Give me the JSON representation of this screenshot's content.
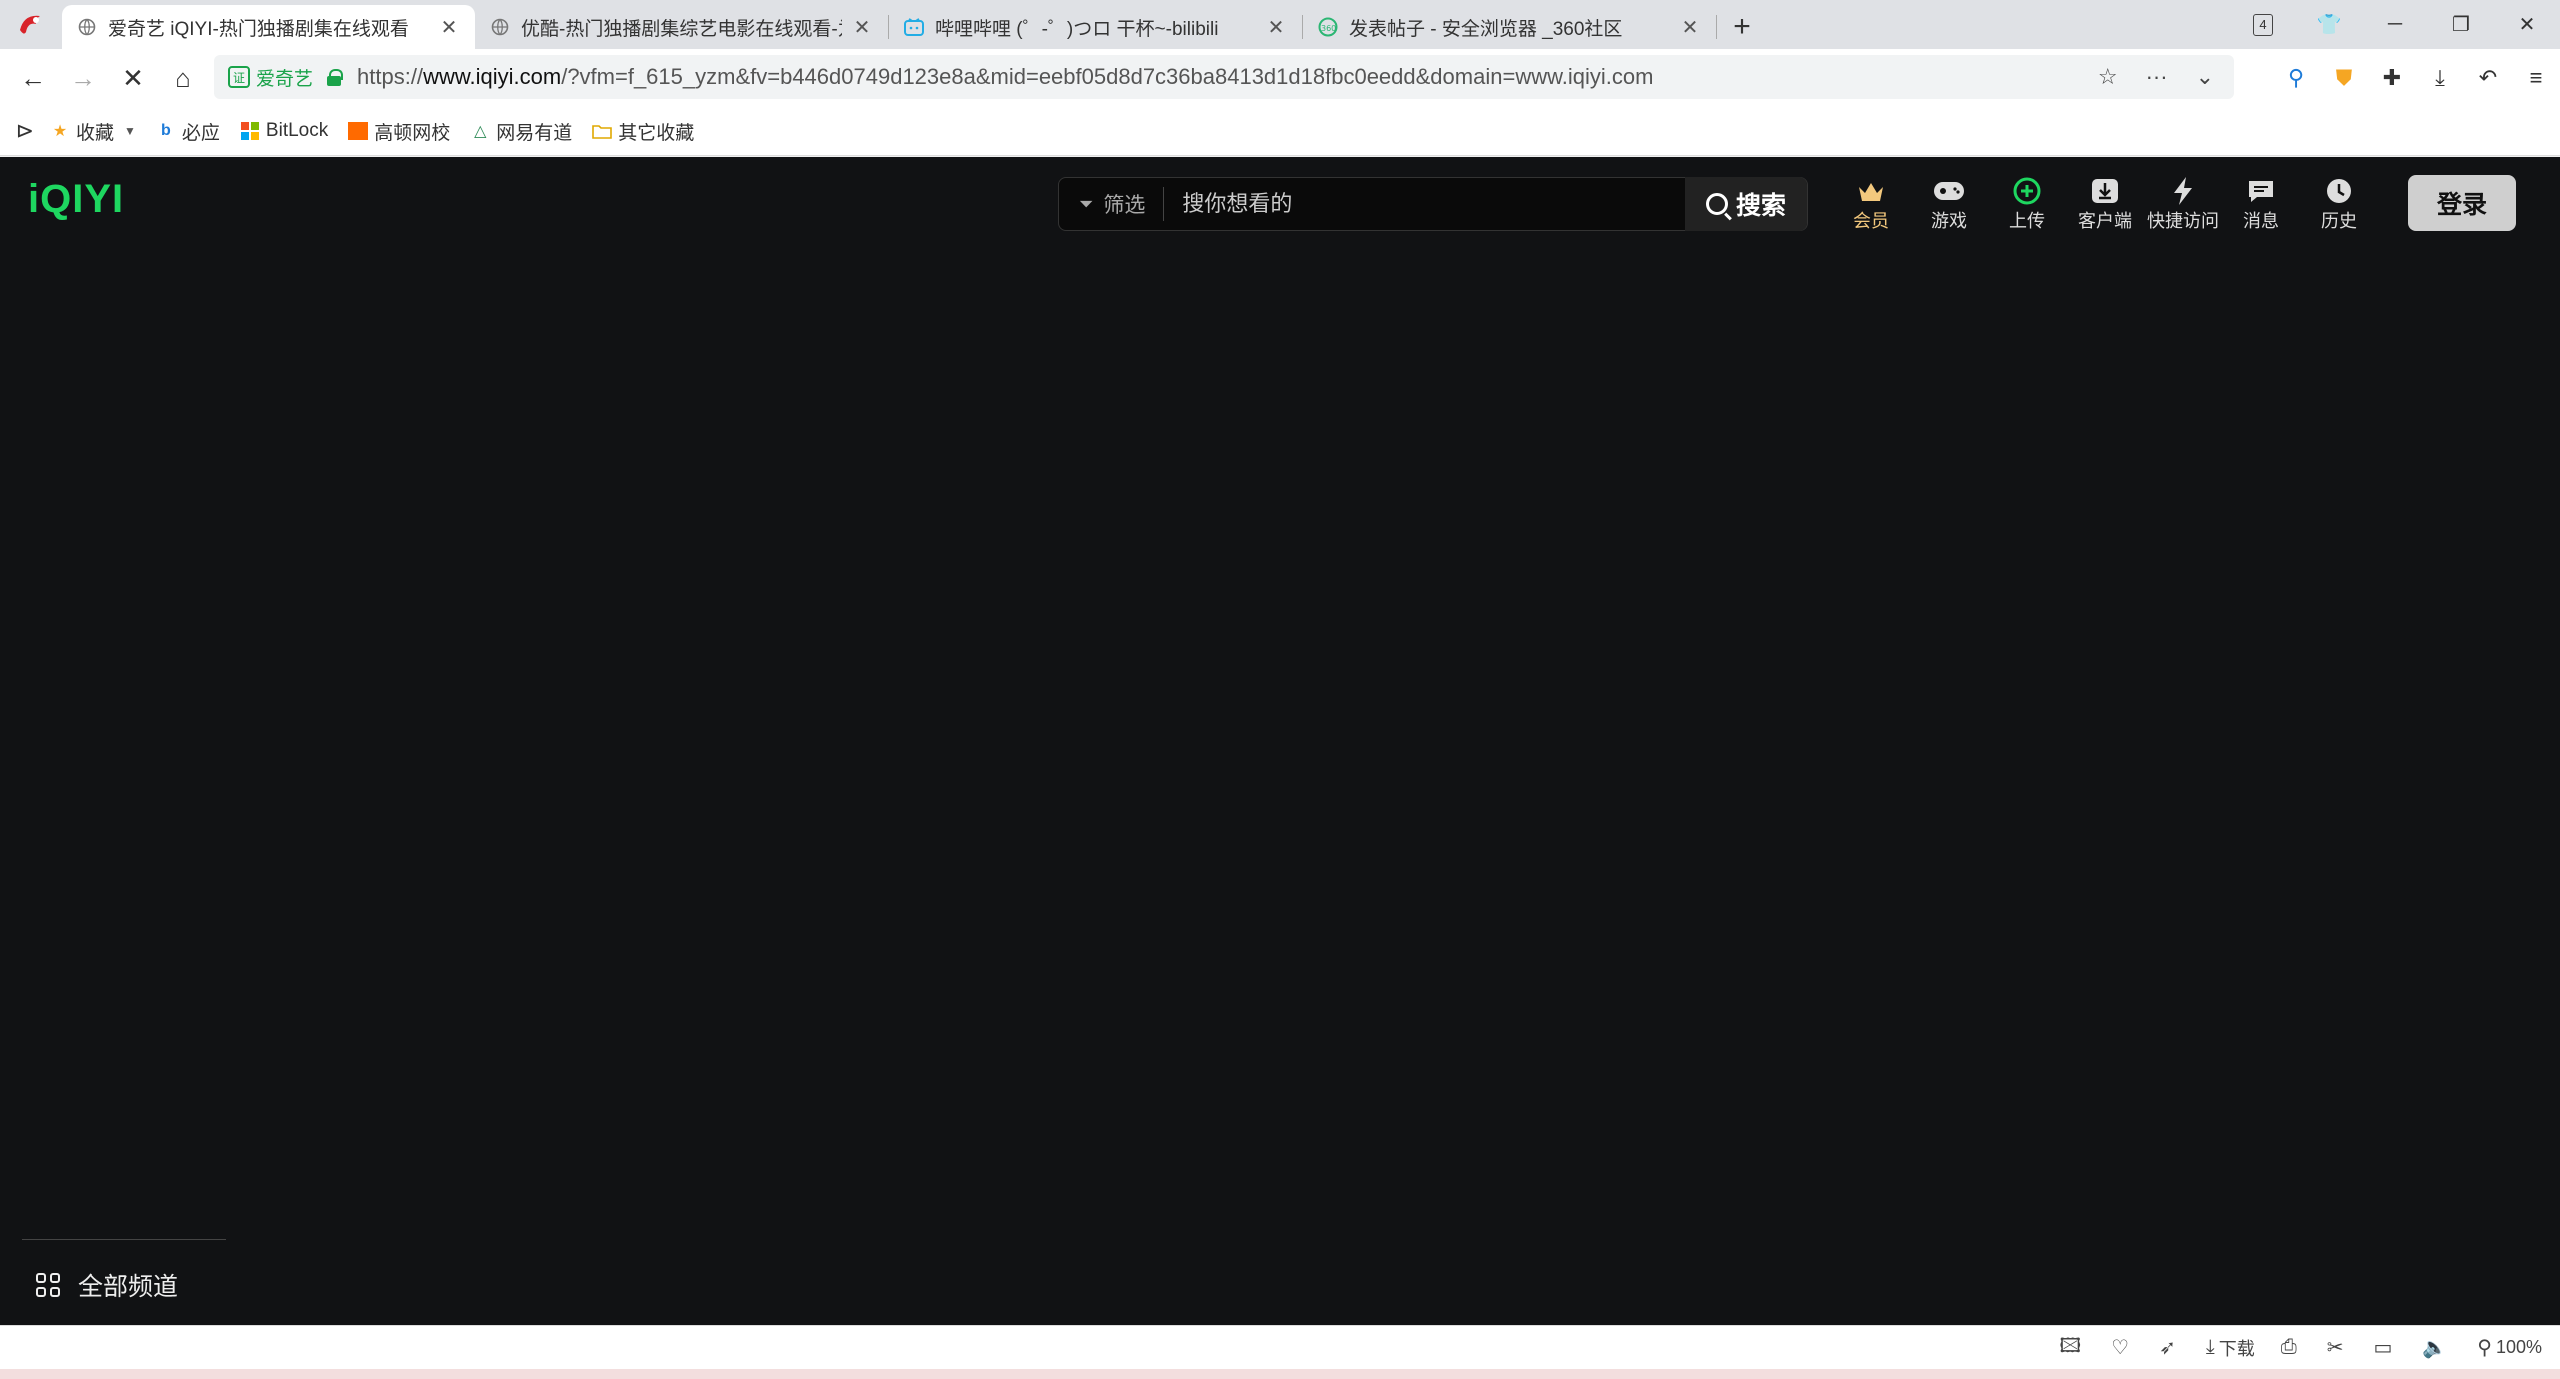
{
  "browser": {
    "tabs": [
      {
        "title": "爱奇艺 iQIYI-热门独播剧集在线观看",
        "active": true
      },
      {
        "title": "优酷-热门独播剧集综艺电影在线观看-为你",
        "active": false
      },
      {
        "title": "哔哩哔哩 (゜-゜)つロ 干杯~-bilibili",
        "active": false
      },
      {
        "title": "发表帖子 - 安全浏览器 _360社区",
        "active": false
      }
    ],
    "tab_count": "4",
    "site_badge": "爱奇艺",
    "url_prefix": "https://",
    "url_domain": "www.iqiyi.com",
    "url_rest": "/?vfm=f_615_yzm&fv=b446d0749d123e8a&mid=eebf05d8d7c36ba8413d1d18fbc0eedd&domain=www.iqiyi.com",
    "bookmarks": [
      {
        "label": "收藏",
        "icon": "star-icon",
        "color": "#f5a623"
      },
      {
        "label": "必应",
        "icon": "bing-icon",
        "color": "#1e7bd8"
      },
      {
        "label": "BitLock",
        "icon": "windows-icon",
        "color": "#f25022"
      },
      {
        "label": "高顿网校",
        "icon": "gaodun-icon",
        "color": "#ff6a00"
      },
      {
        "label": "网易有道",
        "icon": "youdao-icon",
        "color": "#2e8b57"
      },
      {
        "label": "其它收藏",
        "icon": "folder-icon",
        "color": "#f5c242"
      }
    ]
  },
  "page": {
    "logo": "iQIYI",
    "filter_label": "筛选",
    "search_placeholder": "搜你想看的",
    "search_button": "搜索",
    "top_icons": [
      {
        "label": "会员",
        "icon": "crown-icon"
      },
      {
        "label": "游戏",
        "icon": "gamepad-icon"
      },
      {
        "label": "上传",
        "icon": "upload-icon"
      },
      {
        "label": "客户端",
        "icon": "download-icon"
      },
      {
        "label": "快捷访问",
        "icon": "lightning-icon"
      },
      {
        "label": "消息",
        "icon": "message-icon"
      },
      {
        "label": "历史",
        "icon": "clock-icon"
      }
    ],
    "login_button": "登录",
    "all_channels": "全部频道",
    "accent_color": "#1ed760"
  },
  "statusbar": {
    "download_label": "下载",
    "zoom": "100%"
  }
}
